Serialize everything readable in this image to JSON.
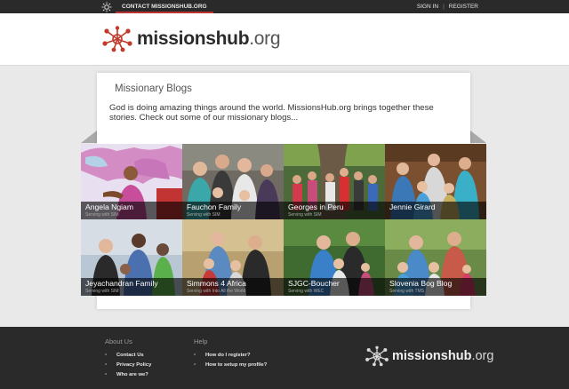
{
  "topbar": {
    "contact_label": "CONTACT MISSIONSHUB.ORG",
    "sign_in": "SIGN IN",
    "separator": "|",
    "register": "REGISTER"
  },
  "header": {
    "logo_bold": "missions",
    "logo_mid": "hub",
    "logo_tld": ".org"
  },
  "main": {
    "title": "Missionary Blogs",
    "intro": "God is doing amazing things around the world. MissionsHub.org brings together these stories. Check out some of our missionary blogs..."
  },
  "blogs": [
    {
      "name": "Angela Ngiam",
      "sub": "Serving with SIM"
    },
    {
      "name": "Fauchon Family",
      "sub": "Serving with SIM"
    },
    {
      "name": "Georges in Peru",
      "sub": "Serving with SIM"
    },
    {
      "name": "Jennie Girard",
      "sub": ""
    },
    {
      "name": "Jeyachandran Family",
      "sub": "Serving with SIM"
    },
    {
      "name": "Simmons 4 Africa",
      "sub": "Serving with Into All the World"
    },
    {
      "name": "SJGC-Boucher",
      "sub": "Serving with WEC"
    },
    {
      "name": "Slovenia Bog Blog",
      "sub": "Serving with TMS"
    }
  ],
  "footer": {
    "about": {
      "heading": "About Us",
      "links": [
        "Contact Us",
        "Privacy Policy",
        "Who are we?"
      ]
    },
    "help": {
      "heading": "Help",
      "links": [
        "How do I register?",
        "How to setup my profile?"
      ]
    }
  },
  "colors": {
    "brand_red": "#c0392b",
    "dark_bar": "#2a2a2a"
  },
  "icons": {
    "topbar": "sun-logo-icon",
    "logo": "network-logo-icon"
  }
}
